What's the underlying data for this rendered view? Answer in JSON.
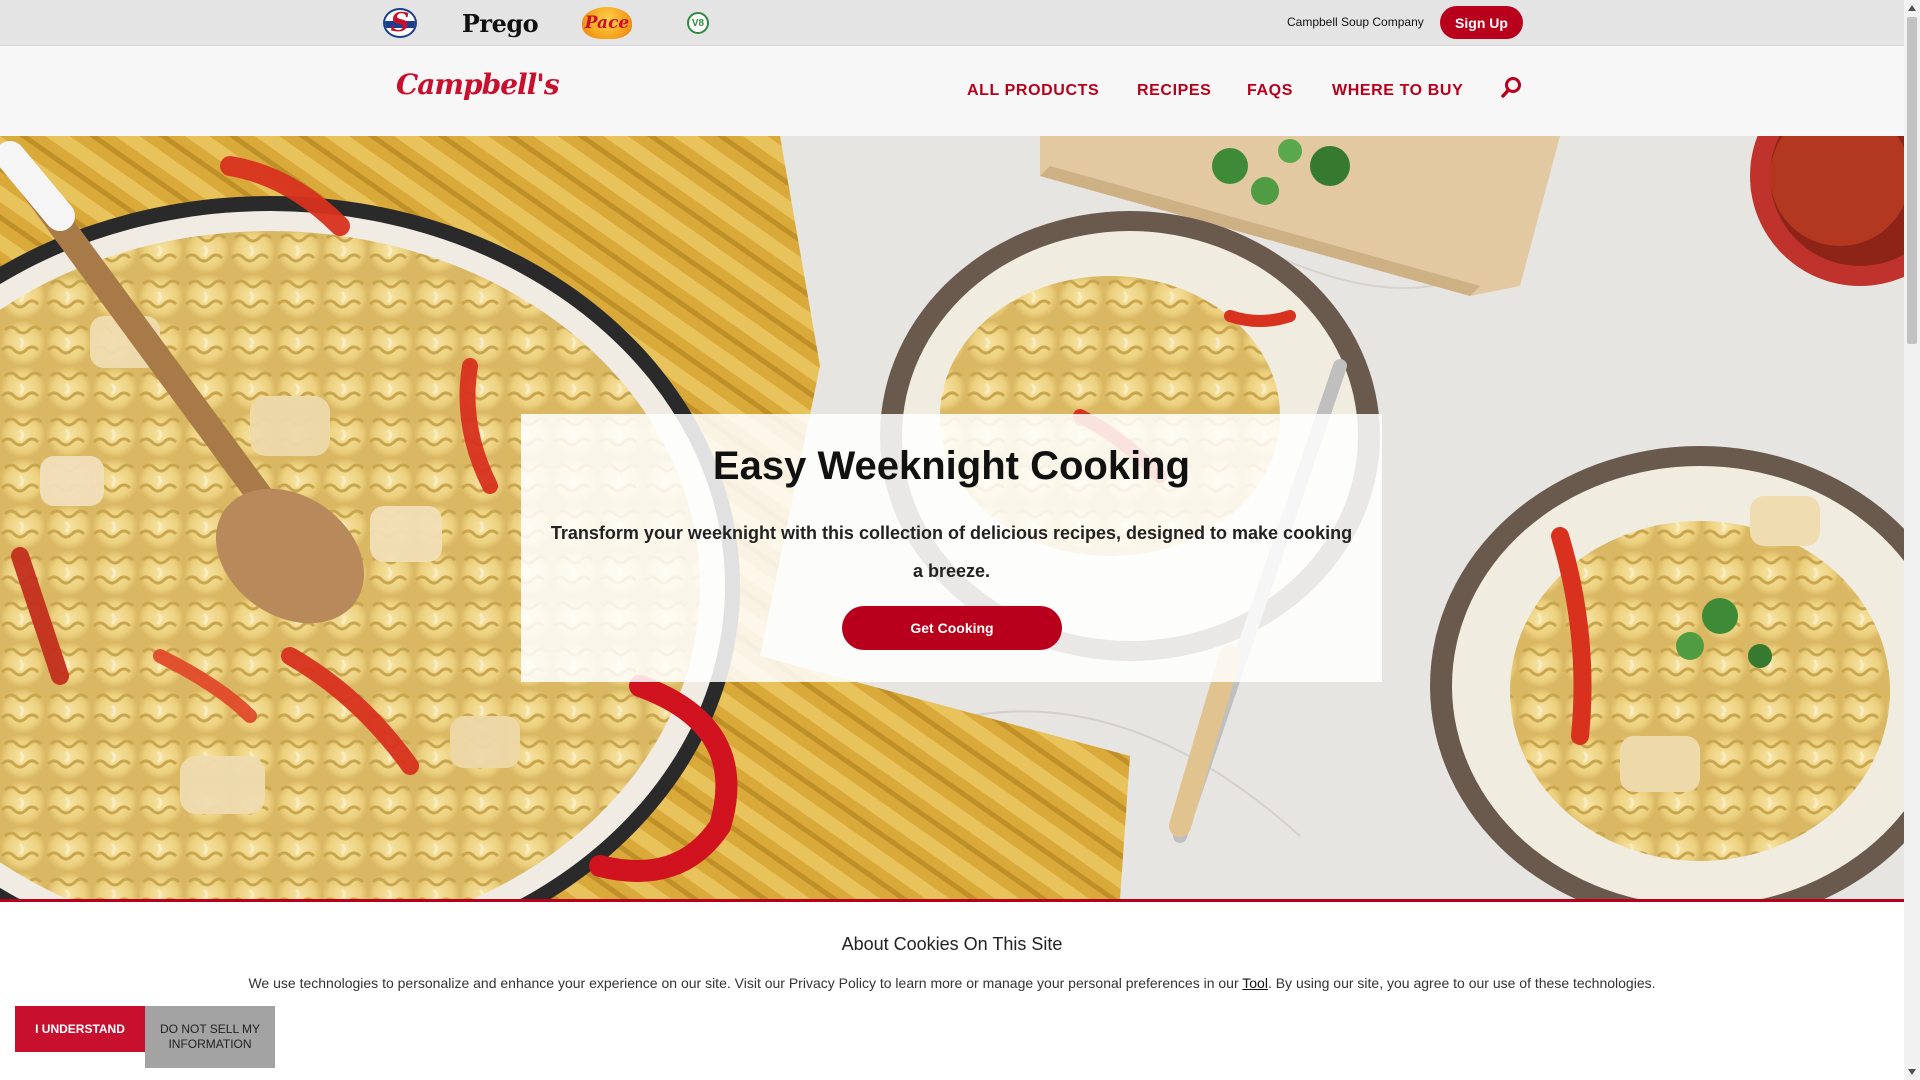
{
  "brand_bar": {
    "logos": {
      "swanson": "SWANSON",
      "prego": "Prego",
      "pace": "Pace",
      "v8": "V8"
    },
    "company_link": "Campbell Soup Company",
    "signup_label": "Sign Up"
  },
  "header": {
    "logo": "Campbell's",
    "nav": {
      "products": "ALL PRODUCTS",
      "recipes": "RECIPES",
      "faqs": "FAQS",
      "where_to_buy": "WHERE TO BUY"
    },
    "search_icon": "search-icon"
  },
  "hero": {
    "title": "Easy Weeknight Cooking",
    "description": "Transform your weeknight with this collection of delicious recipes, designed to make cooking a breeze.",
    "cta_label": "Get Cooking"
  },
  "cookie": {
    "title": "About Cookies On This Site",
    "text_before": "We use technologies to personalize and enhance your experience on our site. Visit our Privacy Policy to learn more or manage your personal preferences in our ",
    "link_label": "Tool",
    "text_after": ". By using our site, you agree to our use of these technologies.",
    "understand_label": "I Understand",
    "do_not_sell_label": "Do Not Sell My Information"
  },
  "colors": {
    "brand_red": "#b8001c",
    "cookie_red": "#c8102e",
    "top_bar": "#e4e4e4"
  }
}
